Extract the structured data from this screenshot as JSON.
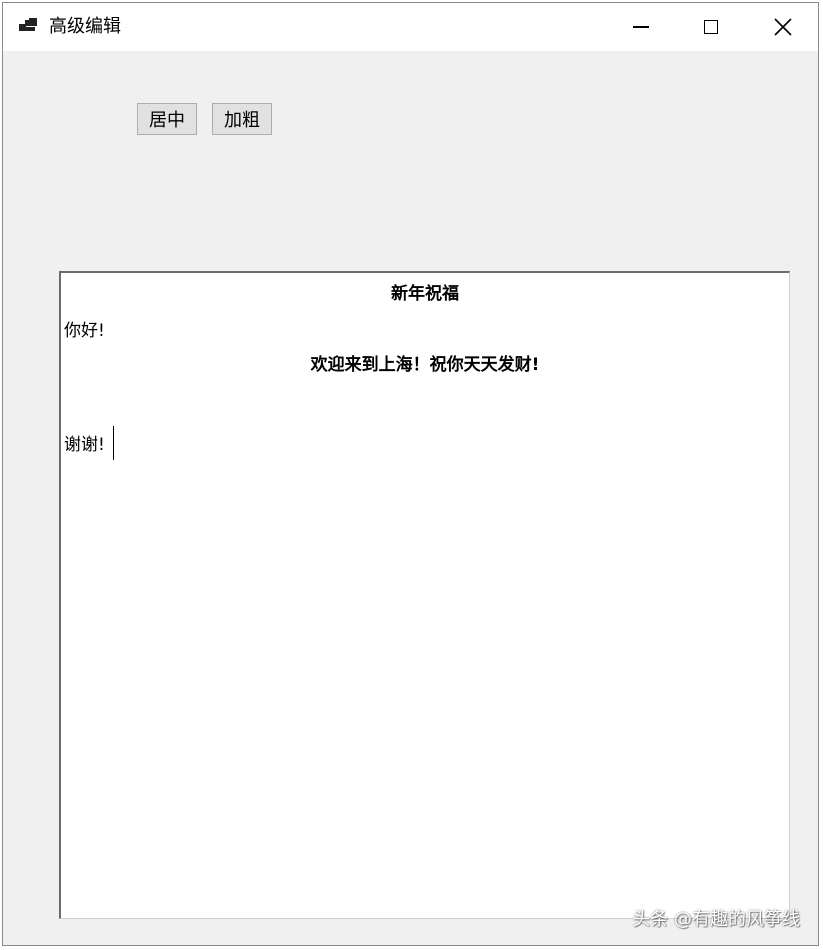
{
  "window": {
    "title": "高级编辑"
  },
  "toolbar": {
    "center_label": "居中",
    "bold_label": "加粗"
  },
  "editor": {
    "lines": [
      {
        "text": "新年祝福",
        "align": "center",
        "bold": true
      },
      {
        "text": "你好!",
        "align": "left",
        "bold": false
      },
      {
        "text": "欢迎来到上海！祝你天天发财!",
        "align": "center",
        "bold": true
      },
      {
        "text": "",
        "align": "left",
        "bold": false
      },
      {
        "text": "谢谢!",
        "align": "left",
        "bold": false
      }
    ]
  },
  "watermark": "头条 @有趣的风筝线"
}
